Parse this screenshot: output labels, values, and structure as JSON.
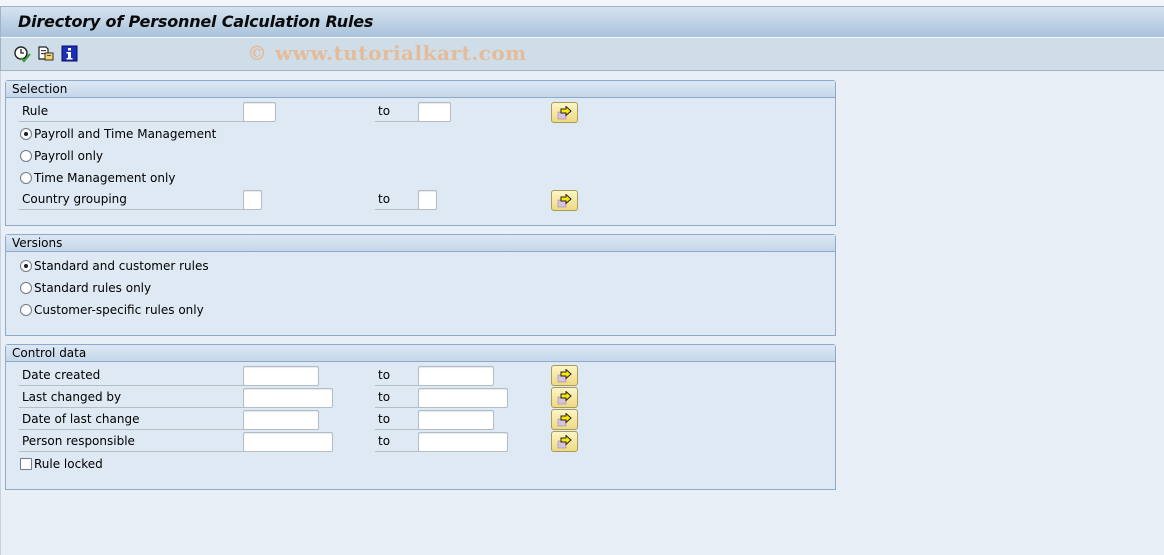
{
  "window": {
    "title": "Directory of Personnel Calculation Rules"
  },
  "toolbar": {
    "buttons": [
      {
        "icon": "execute-clock-icon",
        "tooltip": "Execute"
      },
      {
        "icon": "get-variant-icon",
        "tooltip": "Get Variant"
      },
      {
        "icon": "info-icon",
        "tooltip": "Program documentation"
      }
    ],
    "watermark": "© www.tutorialkart.com"
  },
  "selection": {
    "header": "Selection",
    "rule_label": "Rule",
    "rule_from": "",
    "rule_to": "",
    "to_label": "to",
    "radio_options": [
      {
        "label": "Payroll and Time Management",
        "selected": true
      },
      {
        "label": "Payroll only",
        "selected": false
      },
      {
        "label": "Time Management only",
        "selected": false
      }
    ],
    "country_label": "Country grouping",
    "country_from": "",
    "country_to": ""
  },
  "versions": {
    "header": "Versions",
    "radio_options": [
      {
        "label": "Standard and customer rules",
        "selected": true
      },
      {
        "label": "Standard rules only",
        "selected": false
      },
      {
        "label": "Customer-specific rules only",
        "selected": false
      }
    ]
  },
  "control": {
    "header": "Control data",
    "to_label": "to",
    "fields": [
      {
        "label": "Date created",
        "from": "",
        "to": ""
      },
      {
        "label": "Last changed by",
        "from": "",
        "to": ""
      },
      {
        "label": "Date of last change",
        "from": "",
        "to": ""
      },
      {
        "label": "Person responsible",
        "from": "",
        "to": ""
      }
    ],
    "checkbox_label": "Rule locked",
    "checkbox_checked": false
  },
  "colors": {
    "multiselect_button": "#efd983",
    "group_background": "#dee9f3",
    "page_background": "#e8eff7"
  }
}
